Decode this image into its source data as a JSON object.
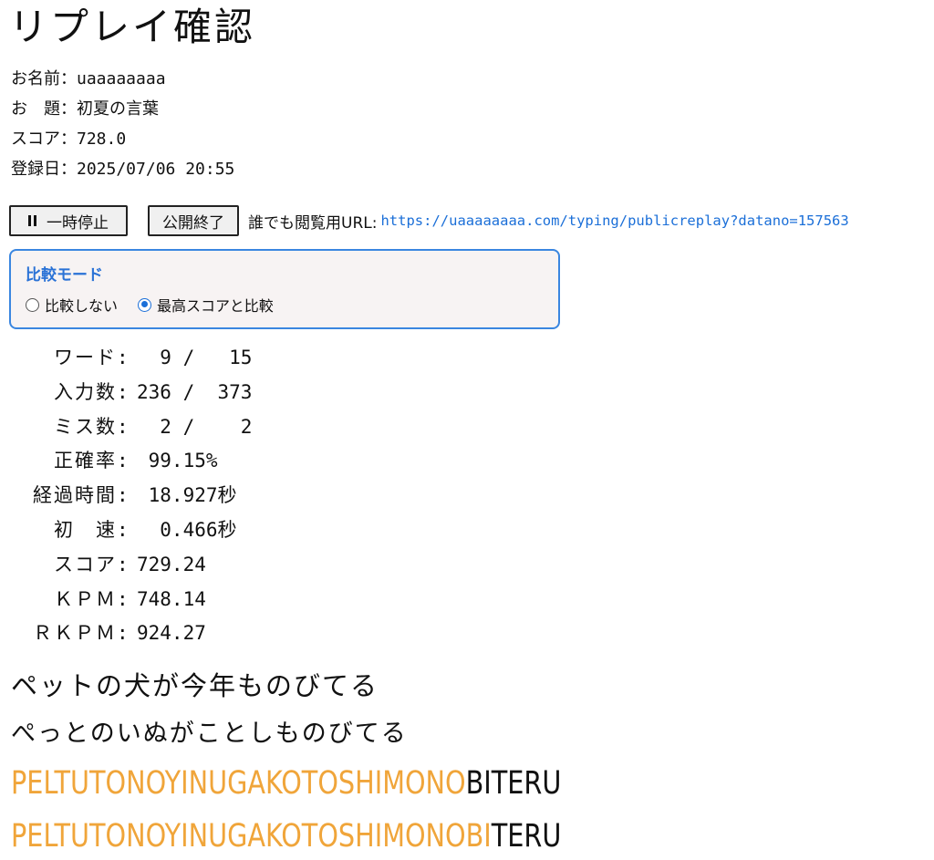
{
  "page": {
    "title": "リプレイ確認"
  },
  "info": [
    {
      "label": "お名前：",
      "value": "uaaaaaaaa"
    },
    {
      "label": "お　題：",
      "value": "初夏の言葉"
    },
    {
      "label": "スコア：",
      "value": "728.0"
    },
    {
      "label": "登録日：",
      "value": "2025/07/06 20:55"
    }
  ],
  "controls": {
    "pause_label": "一時停止",
    "public_end_label": "公開終了",
    "url_label": "誰でも閲覧用URL:",
    "url": "https://uaaaaaaaa.com/typing/publicreplay?datano=157563"
  },
  "compare": {
    "title": "比較モード",
    "options": [
      {
        "label": "比較しない",
        "checked": false
      },
      {
        "label": "最高スコアと比較",
        "checked": true
      }
    ]
  },
  "stats": [
    {
      "label": "ワード",
      "value": "  9 /   15"
    },
    {
      "label": "入力数",
      "value": "236 /  373"
    },
    {
      "label": "ミス数",
      "value": "  2 /    2"
    },
    {
      "label": "正確率",
      "value": " 99.15%"
    },
    {
      "label": "経過時間",
      "value": " 18.927秒"
    },
    {
      "label": "初　速",
      "value": "  0.466秒"
    },
    {
      "label": "スコア",
      "value": "729.24"
    },
    {
      "label": "ＫＰＭ",
      "value": "748.14"
    },
    {
      "label": "ＲＫＰＭ",
      "value": "924.27"
    }
  ],
  "word": {
    "kanji": "ペットの犬が今年ものびてる",
    "kana": "ぺっとのいぬがことしものびてる",
    "romaji_line1_typed": "PELTUTONOYINUGAKOTOSHIMONO",
    "romaji_line1_rest": "BITERU",
    "romaji_line2_typed": "PELTUTONOYINUGAKOTOSHIMONOBI",
    "romaji_line2_rest": "TERU"
  },
  "colors": {
    "typed": "#f0a53a",
    "link": "#1b6fd8",
    "compare_border": "#3a86e0"
  }
}
